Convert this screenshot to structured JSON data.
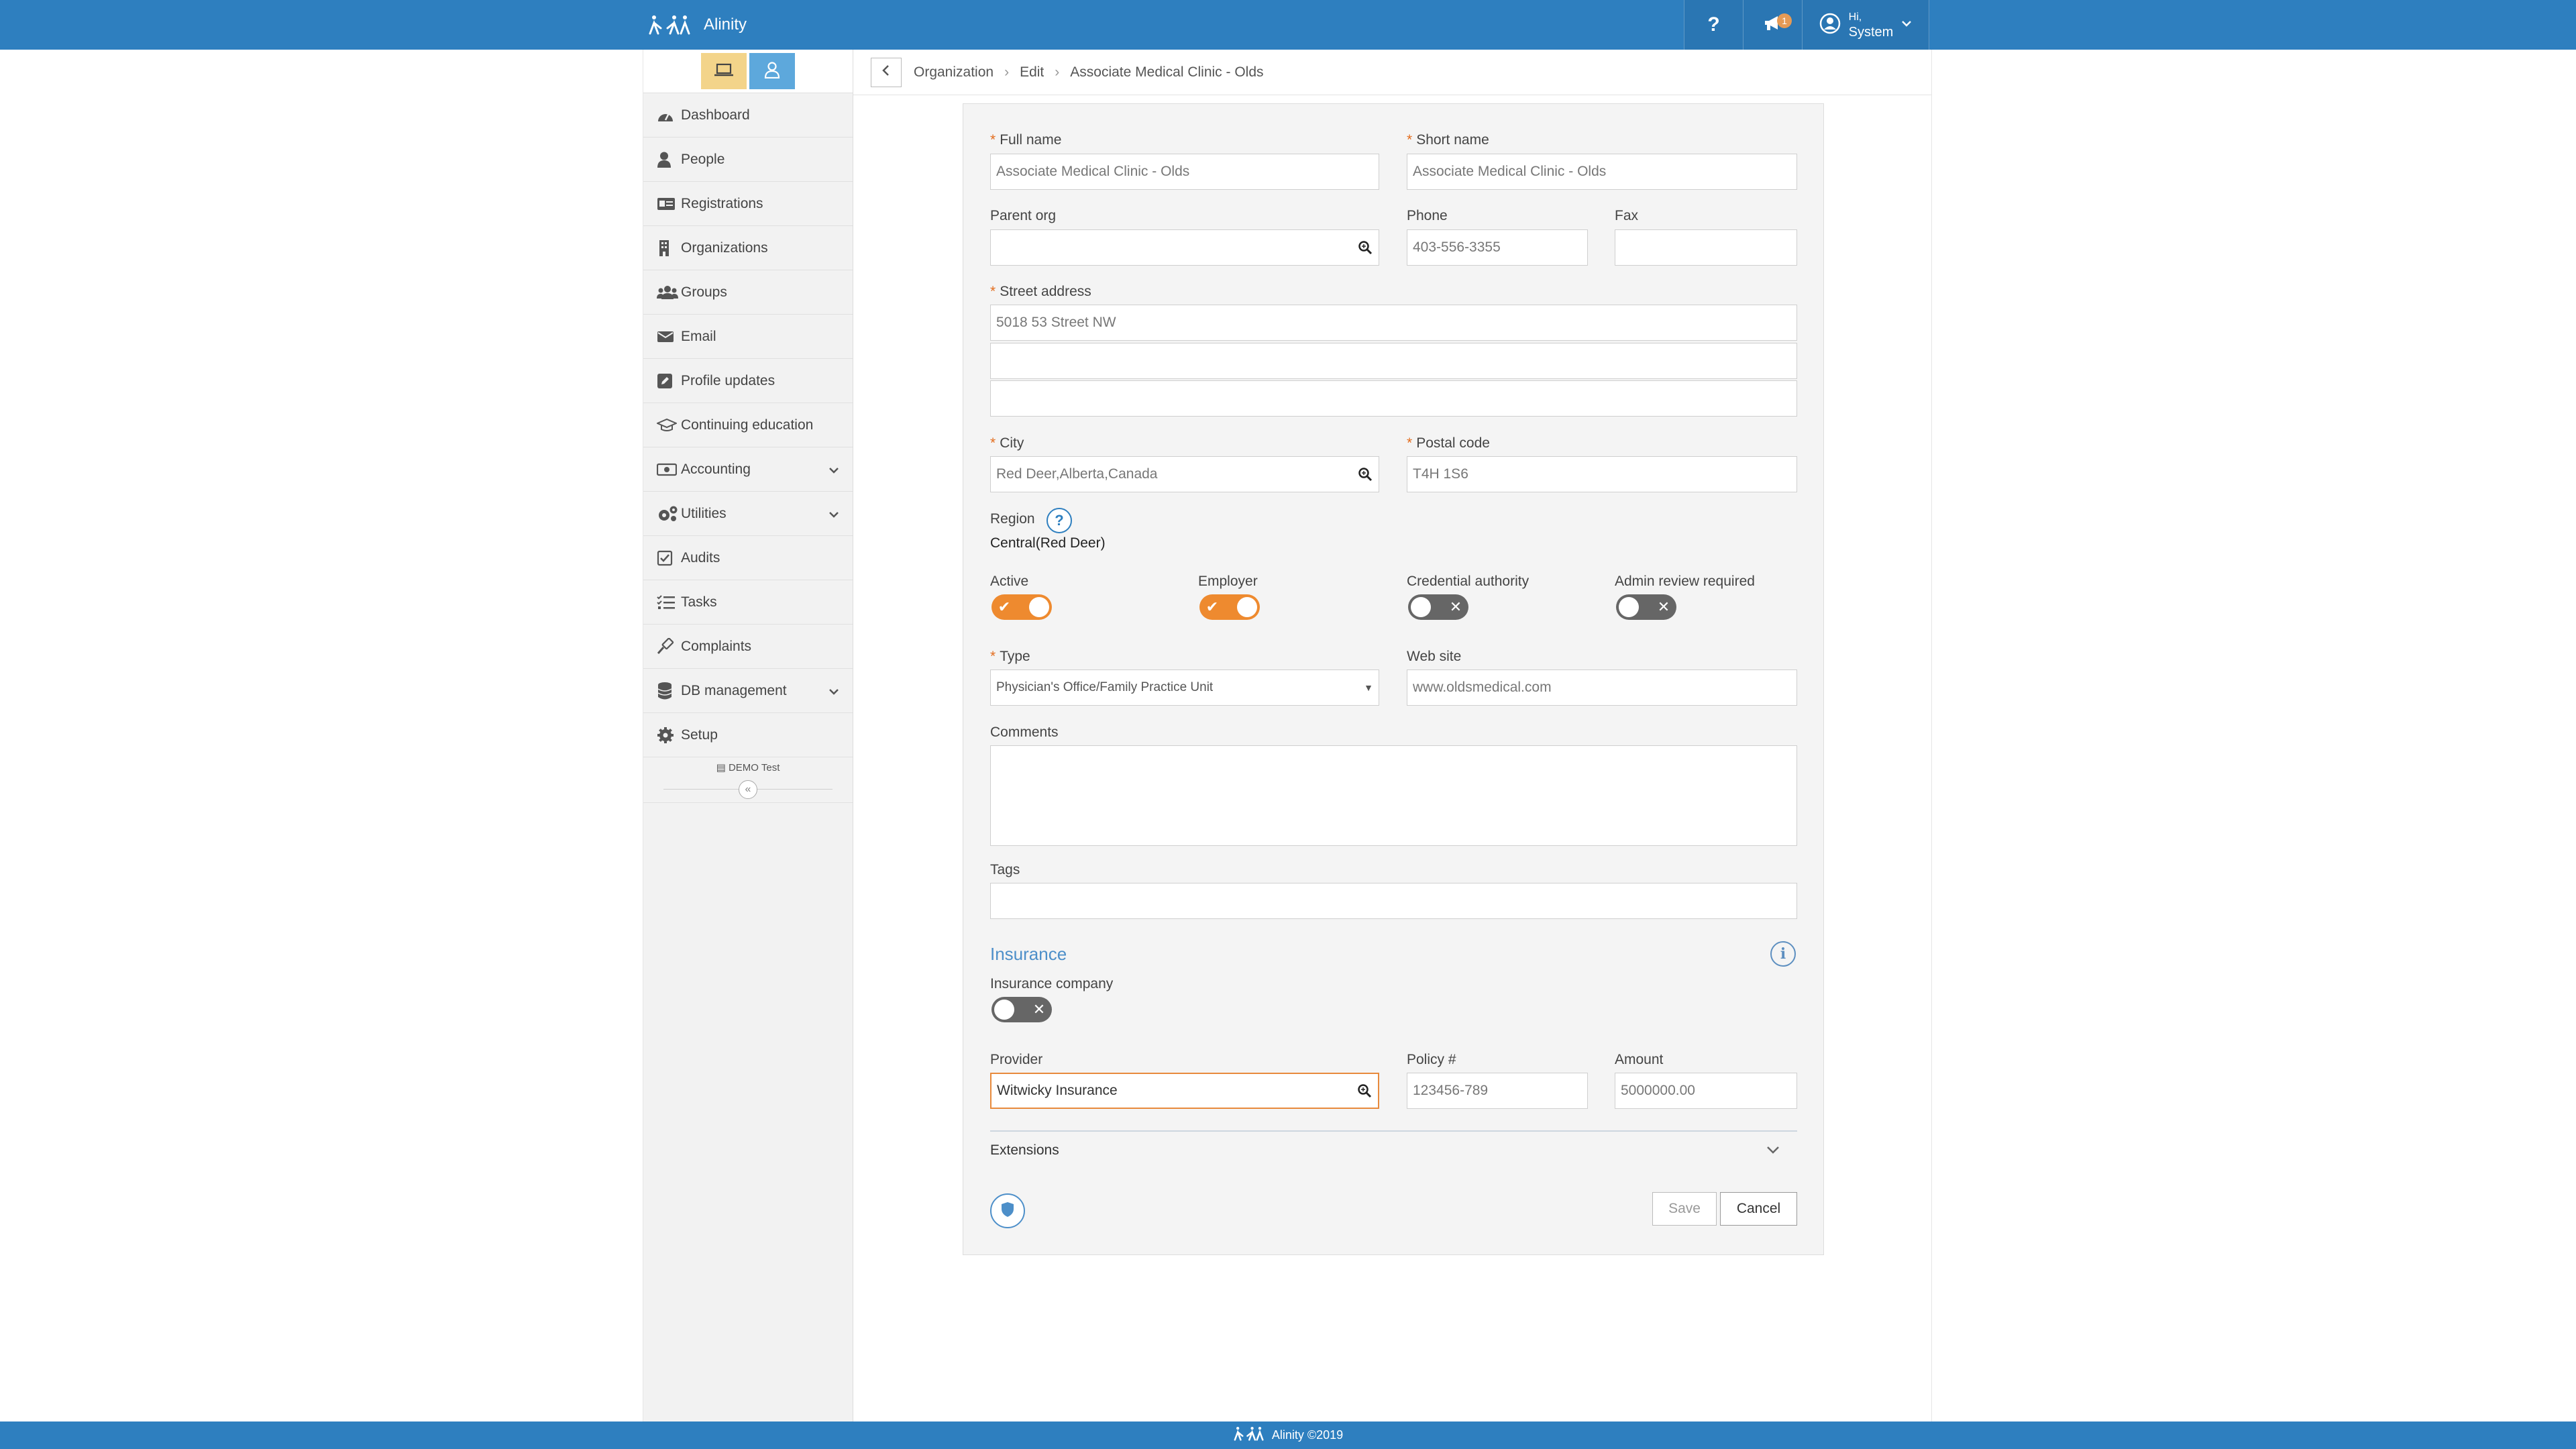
{
  "app": {
    "name": "Alinity"
  },
  "topbar": {
    "help_label": "?",
    "notification_count": "1",
    "user_greeting": "Hi,",
    "user_name": "System"
  },
  "sidebar": {
    "items": [
      {
        "label": "Dashboard",
        "icon": "dashboard-icon"
      },
      {
        "label": "People",
        "icon": "person-icon"
      },
      {
        "label": "Registrations",
        "icon": "id-card-icon"
      },
      {
        "label": "Organizations",
        "icon": "building-icon"
      },
      {
        "label": "Groups",
        "icon": "users-icon"
      },
      {
        "label": "Email",
        "icon": "envelope-icon"
      },
      {
        "label": "Profile updates",
        "icon": "edit-icon"
      },
      {
        "label": "Continuing education",
        "icon": "graduation-cap-icon"
      },
      {
        "label": "Accounting",
        "icon": "money-icon"
      },
      {
        "label": "Utilities",
        "icon": "gears-icon"
      },
      {
        "label": "Audits",
        "icon": "checkbox-icon"
      },
      {
        "label": "Tasks",
        "icon": "tasks-icon"
      },
      {
        "label": "Complaints",
        "icon": "gavel-icon"
      },
      {
        "label": "DB management",
        "icon": "database-icon"
      },
      {
        "label": "Setup",
        "icon": "gear-icon"
      }
    ],
    "demo_label": "DEMO Test",
    "collapse_glyph": "«"
  },
  "breadcrumb": {
    "items": [
      "Organization",
      "Edit",
      "Associate Medical Clinic - Olds"
    ],
    "separator": "›"
  },
  "form": {
    "full_name": {
      "label": "Full name",
      "value": "Associate Medical Clinic - Olds"
    },
    "short_name": {
      "label": "Short name",
      "value": "Associate Medical Clinic - Olds"
    },
    "parent_org": {
      "label": "Parent org",
      "value": ""
    },
    "phone": {
      "label": "Phone",
      "value": "403-556-3355"
    },
    "fax": {
      "label": "Fax",
      "value": ""
    },
    "street_address": {
      "label": "Street address",
      "line1": "5018  53 Street NW",
      "line2": "",
      "line3": ""
    },
    "city": {
      "label": "City",
      "value": "Red Deer,Alberta,Canada"
    },
    "postal_code": {
      "label": "Postal code",
      "value": "T4H 1S6"
    },
    "region": {
      "label": "Region",
      "value": "Central(Red Deer)",
      "help": "?"
    },
    "toggles": {
      "active": {
        "label": "Active",
        "on": true
      },
      "employer": {
        "label": "Employer",
        "on": true
      },
      "credential_authority": {
        "label": "Credential authority",
        "on": false
      },
      "admin_review": {
        "label": "Admin review required",
        "on": false
      }
    },
    "type": {
      "label": "Type",
      "value": "Physician's Office/Family Practice Unit"
    },
    "web_site": {
      "label": "Web site",
      "value": "www.oldsmedical.com"
    },
    "comments": {
      "label": "Comments",
      "value": ""
    },
    "tags": {
      "label": "Tags",
      "value": ""
    },
    "insurance": {
      "title": "Insurance",
      "company_label": "Insurance company",
      "company_on": false,
      "provider": {
        "label": "Provider",
        "value": "Witwicky Insurance"
      },
      "policy": {
        "label": "Policy #",
        "value": "123456-789"
      },
      "amount": {
        "label": "Amount",
        "value": "5000000.00"
      }
    },
    "extensions_label": "Extensions",
    "save_label": "Save",
    "cancel_label": "Cancel",
    "required_mark": "*"
  },
  "footer": {
    "text": "Alinity ©2019"
  },
  "colors": {
    "brand": "#2e7fbf",
    "accent": "#ee8a2f",
    "link": "#4d8fc9"
  }
}
